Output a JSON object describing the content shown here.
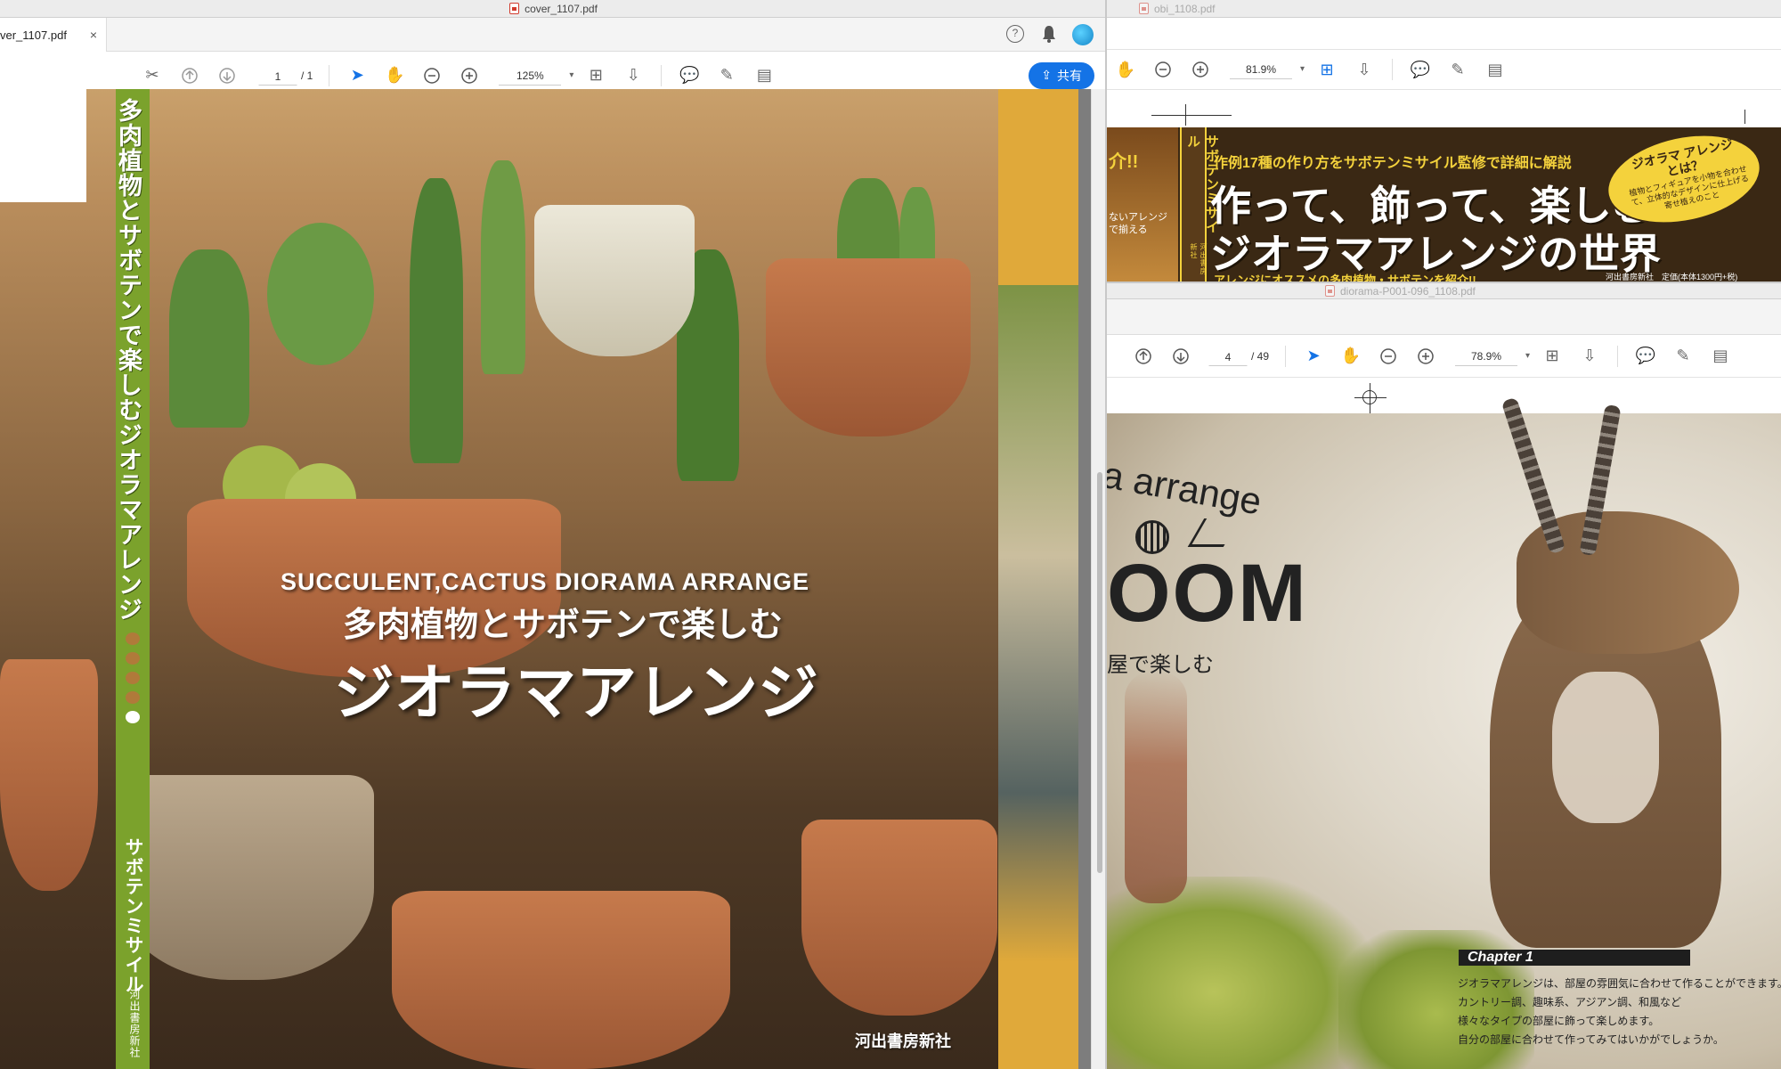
{
  "left_window": {
    "title": "cover_1107.pdf",
    "tab_label": "ver_1107.pdf",
    "page_current": "1",
    "page_total": "/ 1",
    "zoom": "125%",
    "share_label": "共有",
    "cover": {
      "spine_title": "多肉植物とサボテンで楽しむジオラマアレンジ",
      "spine_author": "サボテンミサイル",
      "spine_publisher": "河出書房新社",
      "headline_en": "SUCCULENT,CACTUS DIORAMA ARRANGE",
      "subtitle_jp": "多肉植物とサボテンで楽しむ",
      "title_jp": "ジオラマアレンジ",
      "publisher": "河出書房新社"
    }
  },
  "top_right_window": {
    "title": "obi_1108.pdf",
    "zoom": "81.9%",
    "obi": {
      "left_fragment": "介!!",
      "left_small": "ないアレンジ で揃える",
      "spine_text": "サボテンミサイル",
      "spine_small": "河出書房新社",
      "tagline": "作例17種の作り方をサボテンミサイル監修で詳細に解説",
      "main_line1": "作って、飾って、楽しむ",
      "main_line2": "ジオラマアレンジの世界",
      "badge_title": "ジオラマ アレンジとは？",
      "badge_text": "植物とフィギュアを小物を合わせて、立体的なデザインに仕上げる寄せ植えのこと",
      "bottom_text": "アレンジにオススメの多肉植物・サボテンを紹介!!",
      "bottom_right": "河出書房新社　定価(本体1300円+税)"
    }
  },
  "bottom_right_window": {
    "title": "diorama-P001-096_1108.pdf",
    "page_current": "4",
    "page_total": "/ 49",
    "zoom": "78.9%",
    "spread": {
      "arc_text": "a arrange",
      "room_text": "OOM",
      "sub_text": "屋で楽しむ",
      "chapter": "Chapter 1",
      "body_lines": [
        "ジオラマアレンジは、部屋の雰囲気に合わせて作ることができます。",
        "カントリー調、趣味系、アジアン調、和風など",
        "様々なタイプの部屋に飾って楽しめます。",
        "自分の部屋に合わせて作ってみてはいかがでしょうか。"
      ]
    }
  },
  "colors": {
    "accent": "#1473e6",
    "spine_green": "#7ba22c",
    "mustard": "#e0a93a",
    "obi_yellow": "#f4d23c",
    "obi_dark": "#4a3416"
  }
}
